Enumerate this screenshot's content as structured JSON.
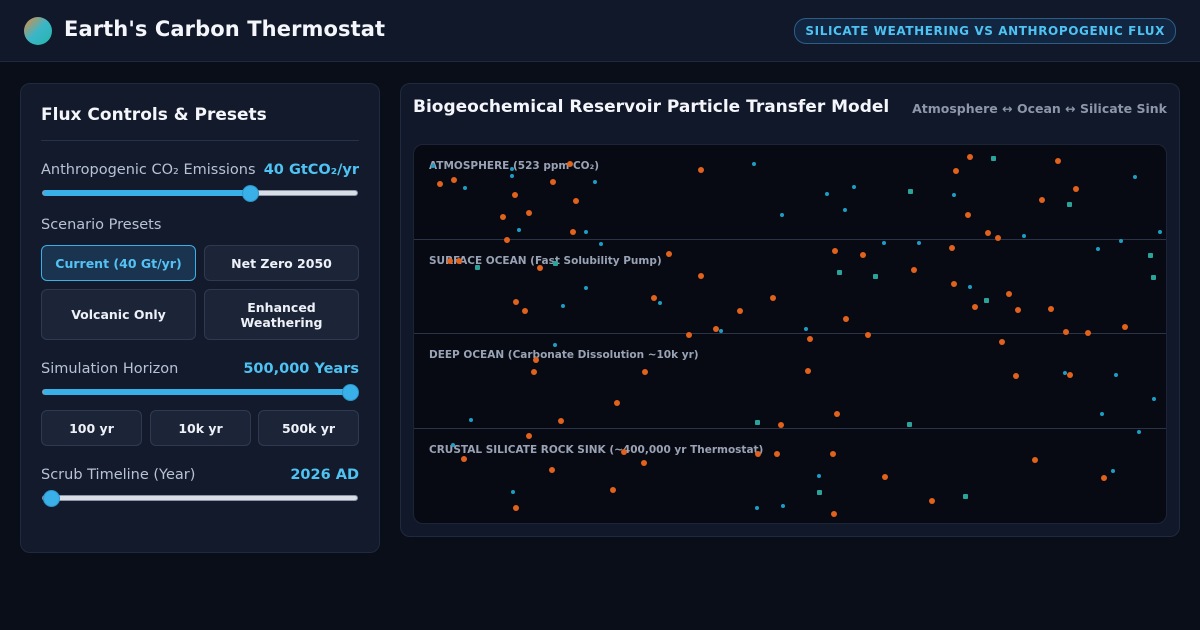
{
  "header": {
    "title": "Earth's Carbon Thermostat",
    "badge": "SILICATE WEATHERING VS ANTHROPOGENIC FLUX"
  },
  "controls": {
    "title": "Flux Controls & Presets",
    "emissions": {
      "label": "Anthropogenic CO₂ Emissions",
      "value": "40 GtCO₂/yr",
      "level": 0.66
    },
    "presets_label": "Scenario Presets",
    "presets": [
      {
        "label": "Current (40 Gt/yr)",
        "active": true
      },
      {
        "label": "Net Zero 2050",
        "active": false
      },
      {
        "label": "Volcanic Only",
        "active": false
      },
      {
        "label": "Enhanced Weathering",
        "active": false
      }
    ],
    "horizon": {
      "label": "Simulation Horizon",
      "value": "500,000 Years",
      "level": 1.0
    },
    "horizon_buttons": [
      "100 yr",
      "10k yr",
      "500k yr"
    ],
    "timeline": {
      "label": "Scrub Timeline (Year)",
      "value": "2026 AD",
      "level": 0.0
    }
  },
  "model": {
    "title": "Biogeochemical Reservoir Particle Transfer Model",
    "subtitle": "Atmosphere ↔ Ocean ↔ Silicate Sink",
    "zones": [
      "ATMOSPHERE (523 ppm CO₂)",
      "SURFACE OCEAN (Fast Solubility Pump)",
      "DEEP OCEAN (Carbonate Dissolution ~10k yr)",
      "CRUSTAL SILICATE ROCK SINK (~400,000 yr Thermostat)"
    ],
    "colors": {
      "co2": "#e0621c",
      "dissolved": "#1d9dc4",
      "silicate": "#2aa39a"
    }
  }
}
